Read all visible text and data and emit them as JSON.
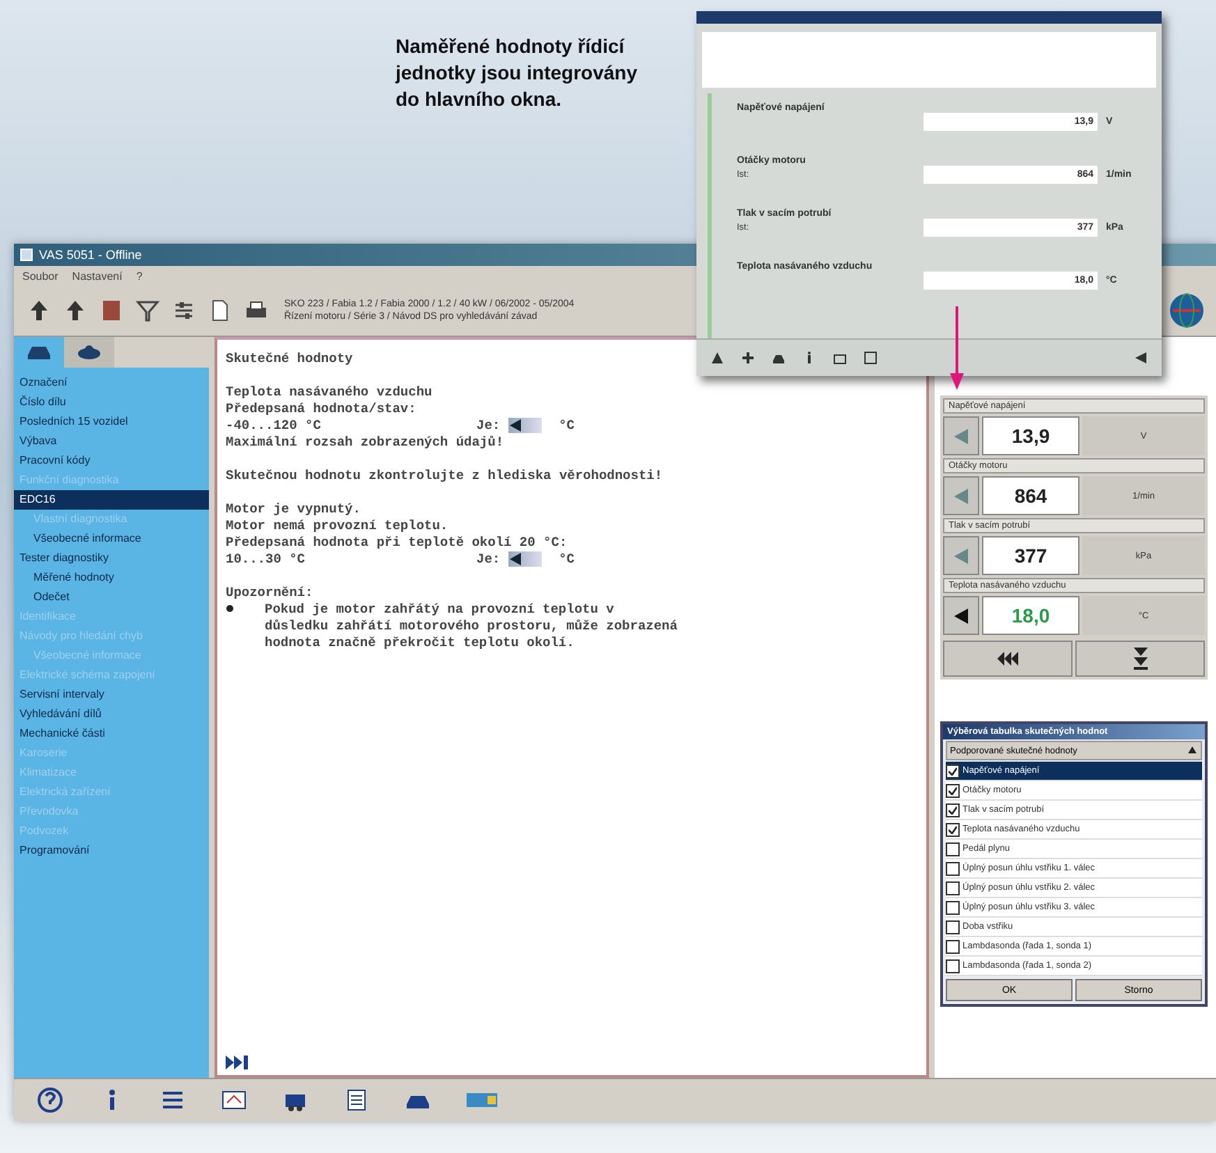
{
  "caption": "Naměřené hodnoty řídicí jednotky jsou integrovány do hlavního okna.",
  "window": {
    "title": "VAS 5051 - Offline",
    "menu": [
      "Soubor",
      "Nastavení",
      "?"
    ],
    "vehicle_info": [
      "SKO 223 / Fabia 1.2 / Fabia 2000 / 1.2 / 40 kW / 06/2002 - 05/2004",
      "Řízení motoru / Série 3 / Návod DS pro vyhledávání závad"
    ]
  },
  "sidebar": {
    "tabs": [
      {
        "selected": true
      },
      {
        "selected": false
      }
    ],
    "items": [
      {
        "label": "Označení",
        "selected": false,
        "disabled": false
      },
      {
        "label": "Číslo dílu",
        "selected": false,
        "disabled": false
      },
      {
        "label": "Posledních 15 vozidel",
        "selected": false,
        "disabled": false
      },
      {
        "label": "Výbava",
        "selected": false,
        "disabled": false
      },
      {
        "label": "Pracovní kódy",
        "selected": false,
        "disabled": false
      },
      {
        "label": "Funkční diagnostika",
        "selected": false,
        "disabled": true
      },
      {
        "label": "EDC16",
        "selected": true,
        "disabled": false,
        "children": [
          {
            "label": "Vlastní diagnostika",
            "selected": false,
            "disabled": true
          },
          {
            "label": "Všeobecné informace",
            "selected": false,
            "disabled": false
          }
        ]
      },
      {
        "label": "Tester diagnostiky",
        "selected": false,
        "disabled": false,
        "children": [
          {
            "label": "Měřené hodnoty",
            "selected": false,
            "disabled": false
          },
          {
            "label": "Odečet",
            "selected": false,
            "disabled": false
          }
        ]
      },
      {
        "label": "Identifikace",
        "selected": false,
        "disabled": true
      },
      {
        "label": "Návody pro hledání chyb",
        "selected": false,
        "disabled": true,
        "children": [
          {
            "label": "Všeobecné informace",
            "selected": false,
            "disabled": true
          }
        ]
      },
      {
        "label": "Elektrické schéma zapojení",
        "selected": false,
        "disabled": true
      },
      {
        "label": "Servisní intervaly",
        "selected": false,
        "disabled": false
      },
      {
        "label": "Vyhledávání dílů",
        "selected": false,
        "disabled": false
      },
      {
        "label": "Mechanické části",
        "selected": false,
        "disabled": false
      },
      {
        "label": "Karoserie",
        "selected": false,
        "disabled": true
      },
      {
        "label": "Klimatizace",
        "selected": false,
        "disabled": true
      },
      {
        "label": "Elektrická zařízení",
        "selected": false,
        "disabled": true
      },
      {
        "label": "Převodovka",
        "selected": false,
        "disabled": true
      },
      {
        "label": "Podvozek",
        "selected": false,
        "disabled": true
      },
      {
        "label": "Programování",
        "selected": false,
        "disabled": false
      }
    ]
  },
  "document": {
    "lines": [
      {
        "kind": "text",
        "text": "Skutečné hodnoty"
      },
      {
        "kind": "blank"
      },
      {
        "kind": "text",
        "text": "Teplota nasávaného vzduchu"
      },
      {
        "kind": "text",
        "text": "Předepsaná hodnota/stav:"
      },
      {
        "kind": "reading",
        "range": "-40...120 °C",
        "label": "Je:",
        "unit": "°C"
      },
      {
        "kind": "text",
        "text": "Maximální rozsah zobrazených údajů!"
      },
      {
        "kind": "blank"
      },
      {
        "kind": "text",
        "text": "Skutečnou hodnotu zkontrolujte z hlediska věrohodnosti!"
      },
      {
        "kind": "blank"
      },
      {
        "kind": "text",
        "text": "Motor je vypnutý."
      },
      {
        "kind": "text",
        "text": "Motor nemá provozní teplotu."
      },
      {
        "kind": "text",
        "text": "Předepsaná hodnota při teplotě okolí 20 °C:"
      },
      {
        "kind": "reading",
        "range": "10...30 °C",
        "label": "Je:",
        "unit": "°C"
      },
      {
        "kind": "blank"
      },
      {
        "kind": "text",
        "text": "Upozornění:"
      },
      {
        "kind": "bullet",
        "text": "Pokud je motor zahřátý na provozní teplotu v důsledku zahřátí motorového prostoru, může zobrazená hodnota značně překročit teplotu okolí."
      }
    ]
  },
  "measured_values": [
    {
      "name": "Napěťové napájení",
      "value": "13,9",
      "unit": "V",
      "highlighted": false
    },
    {
      "name": "Otáčky motoru",
      "value": "864",
      "unit": "1/min",
      "highlighted": false
    },
    {
      "name": "Tlak v sacím potrubí",
      "value": "377",
      "unit": "kPa",
      "highlighted": false
    },
    {
      "name": "Teplota nasávaného vzduchu",
      "value": "18,0",
      "unit": "°C",
      "highlighted": true
    }
  ],
  "selection_list": {
    "title": "Výběrová tabulka skutečných hodnot",
    "header": "Podporované skutečné hodnoty",
    "items": [
      {
        "label": "Napěťové napájení",
        "checked": true,
        "selected": true
      },
      {
        "label": "Otáčky motoru",
        "checked": true,
        "selected": false
      },
      {
        "label": "Tlak v sacím potrubí",
        "checked": true,
        "selected": false
      },
      {
        "label": "Teplota nasávaného vzduchu",
        "checked": true,
        "selected": false
      },
      {
        "label": "Pedál plynu",
        "checked": false,
        "selected": false
      },
      {
        "label": "Úplný posun úhlu vstřiku 1. válec",
        "checked": false,
        "selected": false
      },
      {
        "label": "Úplný posun úhlu vstřiku 2. válec",
        "checked": false,
        "selected": false
      },
      {
        "label": "Úplný posun úhlu vstřiku 3. válec",
        "checked": false,
        "selected": false
      },
      {
        "label": "Doba vstřiku",
        "checked": false,
        "selected": false
      },
      {
        "label": "Lambdasonda (řada 1, sonda 1)",
        "checked": false,
        "selected": false
      },
      {
        "label": "Lambdasonda (řada 1, sonda 2)",
        "checked": false,
        "selected": false
      }
    ],
    "buttons": [
      "OK",
      "Storno"
    ]
  },
  "popup": {
    "rows": [
      {
        "name": "Napěťové napájení",
        "value": "13,9",
        "unit": "V"
      },
      {
        "name": "Otáčky motoru",
        "sub": "Ist:",
        "value": "864",
        "unit": "1/min"
      },
      {
        "name": "Tlak v sacím potrubí",
        "sub": "Ist:",
        "value": "377",
        "unit": "kPa"
      },
      {
        "name": "Teplota nasávaného vzduchu",
        "value": "18,0",
        "unit": "°C"
      }
    ]
  }
}
